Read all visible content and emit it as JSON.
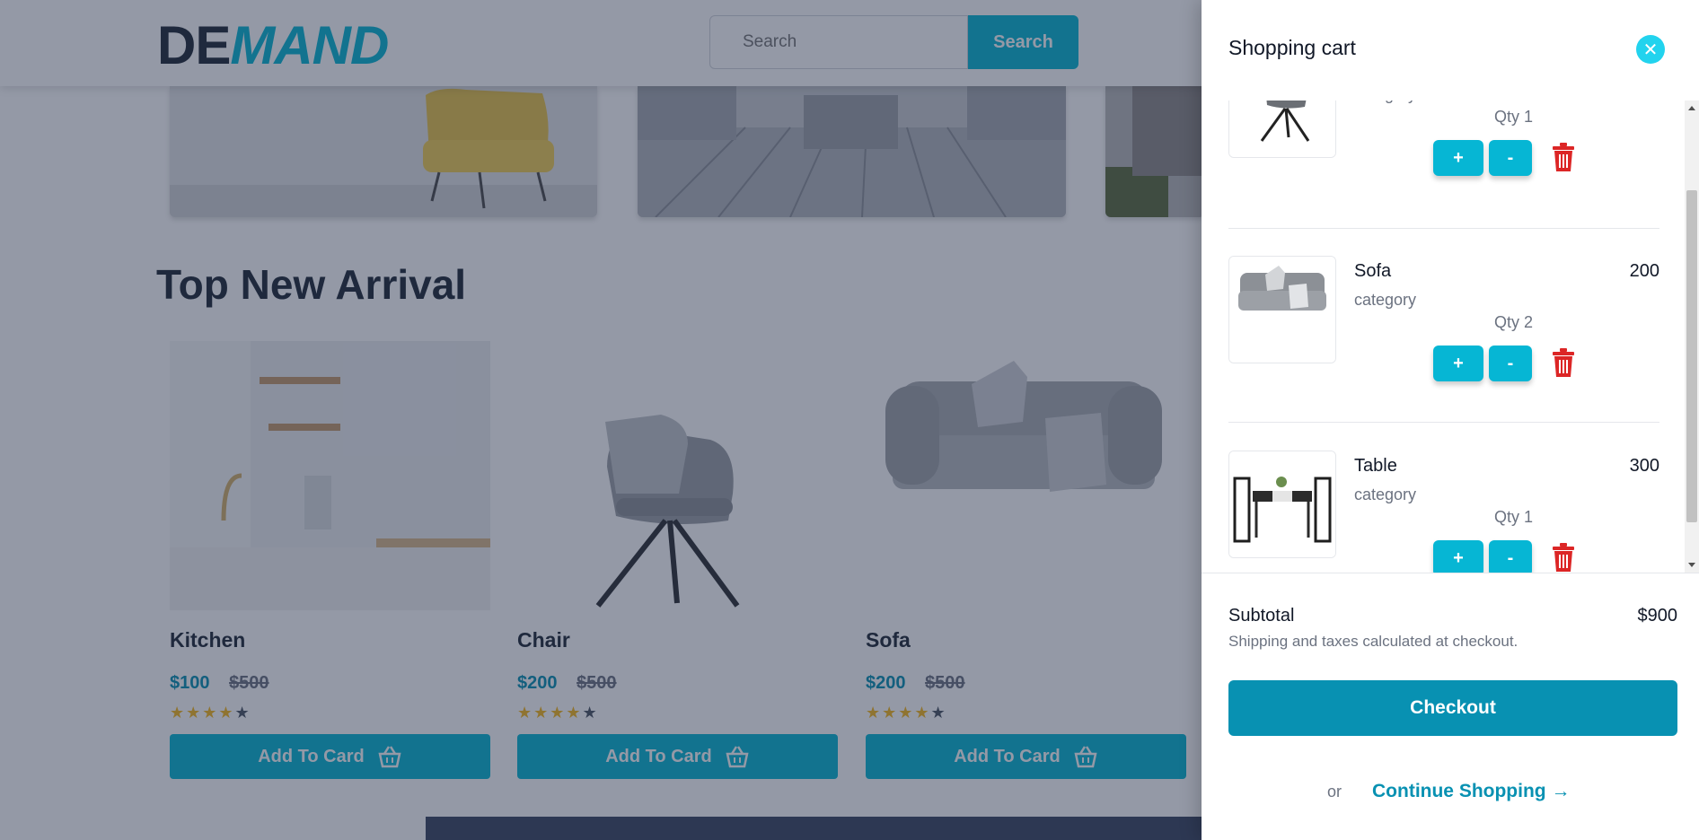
{
  "header": {
    "logo_part1": "DE",
    "logo_part2": "MAND",
    "search_placeholder": "Search",
    "search_button": "Search"
  },
  "section": {
    "title": "Top New Arrival"
  },
  "products": [
    {
      "name": "Kitchen",
      "price": "$100",
      "old_price": "$500",
      "stars_on": "★★★★",
      "stars_off": "★",
      "button": "Add To Card"
    },
    {
      "name": "Chair",
      "price": "$200",
      "old_price": "$500",
      "stars_on": "★★★★",
      "stars_off": "★",
      "button": "Add To Card"
    },
    {
      "name": "Sofa",
      "price": "$200",
      "old_price": "$500",
      "stars_on": "★★★★",
      "stars_off": "★",
      "button": "Add To Card"
    }
  ],
  "cart": {
    "title": "Shopping cart",
    "close_icon": "close-icon",
    "items": [
      {
        "name": "",
        "price": "",
        "category": "category",
        "qty": "Qty 1",
        "plus": "+",
        "minus": "-"
      },
      {
        "name": "Sofa",
        "price": "200",
        "category": "category",
        "qty": "Qty 2",
        "plus": "+",
        "minus": "-"
      },
      {
        "name": "Table",
        "price": "300",
        "category": "category",
        "qty": "Qty 1",
        "plus": "+",
        "minus": "-"
      }
    ],
    "subtotal_label": "Subtotal",
    "subtotal_value": "$900",
    "shipping_note": "Shipping and taxes calculated at checkout.",
    "checkout_button": "Checkout",
    "or_text": "or",
    "continue_link": "Continue Shopping →"
  },
  "colors": {
    "accent": "#06b6d4",
    "accent_dark": "#0891b2",
    "delete": "#dc2626",
    "star": "#f5b820"
  }
}
